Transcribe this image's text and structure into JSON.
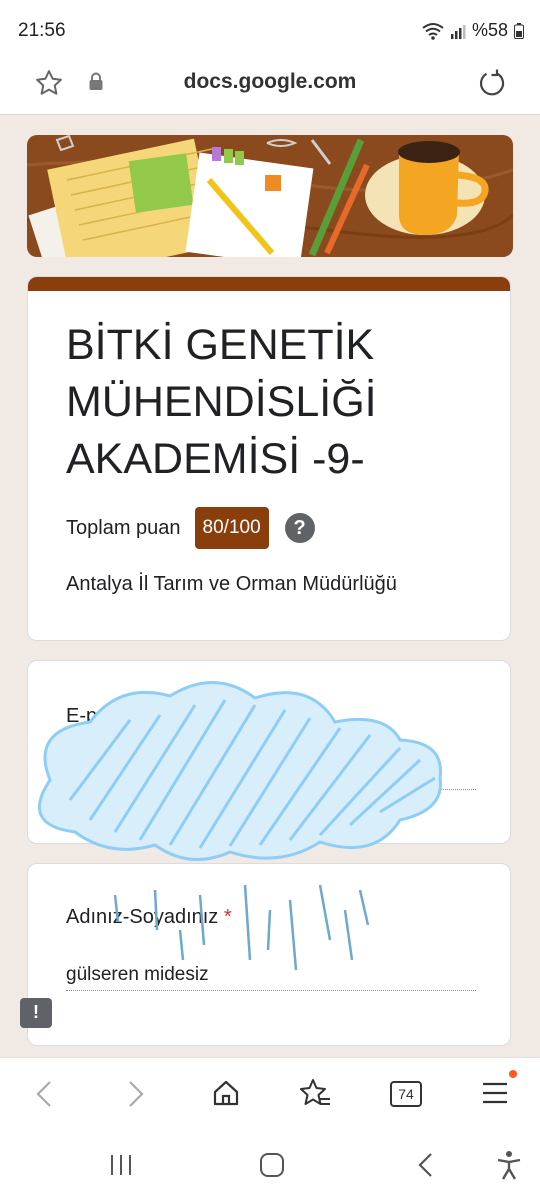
{
  "status_bar": {
    "time": "21:56",
    "battery": "%58"
  },
  "browser": {
    "url": "docs.google.com"
  },
  "form": {
    "title": "BİTKİ GENETİK MÜHENDİSLİĞİ AKADEMİSİ -9-",
    "score_label": "Toplam puan",
    "score_value": "80/100",
    "help_symbol": "?",
    "description": "Antalya İl Tarım ve Orman Müdürlüğü",
    "email_label": "E-posta",
    "name_label": "Adınız-Soyadınız",
    "required_mark": "*",
    "name_value": "gülseren midesiz"
  },
  "feedback_symbol": "!",
  "bottom_toolbar": {
    "tabs_count": "74"
  },
  "colors": {
    "accent": "#8a3e0b",
    "required": "#d93025",
    "scribble": "#8ecdf5"
  }
}
